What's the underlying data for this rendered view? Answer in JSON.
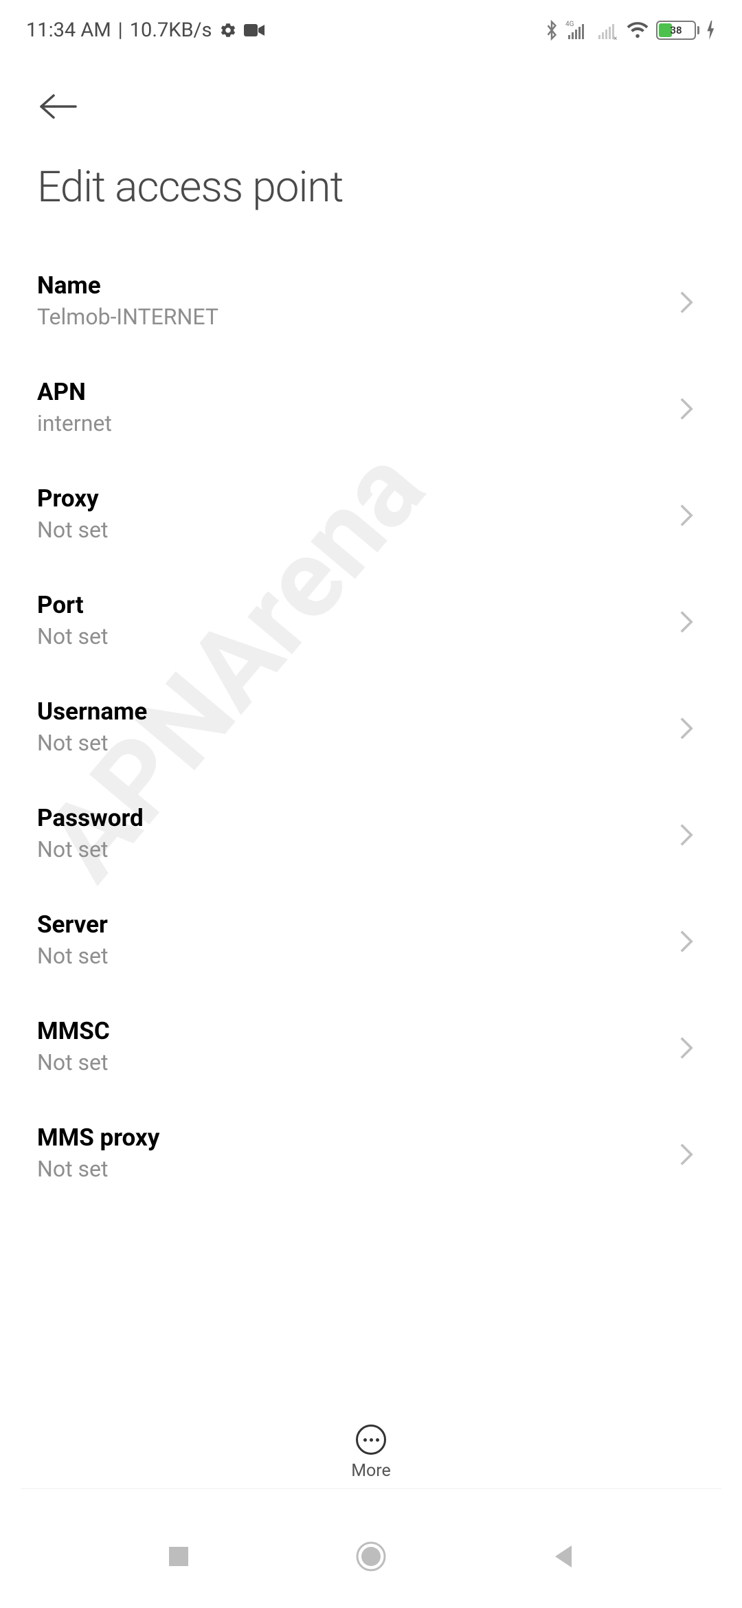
{
  "status_bar": {
    "time": "11:34 AM",
    "separator": "|",
    "speed": "10.7KB/s",
    "battery_level": "38"
  },
  "header": {
    "title": "Edit access point"
  },
  "settings": [
    {
      "label": "Name",
      "value": "Telmob-INTERNET"
    },
    {
      "label": "APN",
      "value": "internet"
    },
    {
      "label": "Proxy",
      "value": "Not set"
    },
    {
      "label": "Port",
      "value": "Not set"
    },
    {
      "label": "Username",
      "value": "Not set"
    },
    {
      "label": "Password",
      "value": "Not set"
    },
    {
      "label": "Server",
      "value": "Not set"
    },
    {
      "label": "MMSC",
      "value": "Not set"
    },
    {
      "label": "MMS proxy",
      "value": "Not set"
    }
  ],
  "bottom": {
    "more_label": "More"
  },
  "watermark": "APNArena"
}
